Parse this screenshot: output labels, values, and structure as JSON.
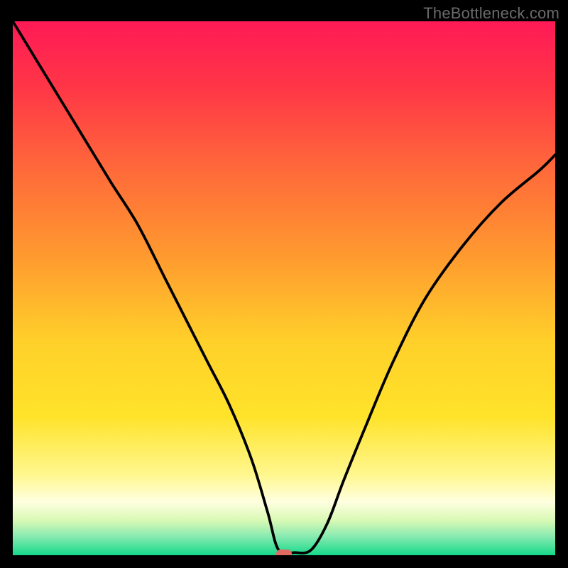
{
  "watermark": "TheBottleneck.com",
  "chart_data": {
    "type": "line",
    "title": "",
    "xlabel": "",
    "ylabel": "",
    "xlim": [
      0,
      100
    ],
    "ylim": [
      0,
      100
    ],
    "grid": false,
    "legend": false,
    "gradient_stops": [
      {
        "t": 0.0,
        "color": "#ff1a56"
      },
      {
        "t": 0.12,
        "color": "#ff3547"
      },
      {
        "t": 0.28,
        "color": "#ff6a3a"
      },
      {
        "t": 0.44,
        "color": "#ff9a2f"
      },
      {
        "t": 0.6,
        "color": "#ffd02a"
      },
      {
        "t": 0.74,
        "color": "#ffe32a"
      },
      {
        "t": 0.85,
        "color": "#fff78f"
      },
      {
        "t": 0.9,
        "color": "#ffffe0"
      },
      {
        "t": 0.935,
        "color": "#d8f9b5"
      },
      {
        "t": 0.965,
        "color": "#87eab0"
      },
      {
        "t": 1.0,
        "color": "#15d98a"
      }
    ],
    "marker": {
      "x": 50,
      "y": 0,
      "color": "#e26a63"
    },
    "series": [
      {
        "name": "curve",
        "x": [
          0,
          6,
          12,
          18,
          23,
          28,
          32,
          36,
          40,
          44,
          47,
          49,
          52,
          55,
          58,
          61,
          65,
          70,
          76,
          83,
          90,
          97,
          100
        ],
        "y": [
          100,
          90,
          80,
          70,
          62,
          52,
          44,
          36,
          28,
          18,
          8,
          1,
          0.5,
          1,
          6,
          14,
          24,
          36,
          48,
          58,
          66,
          72,
          75
        ]
      }
    ]
  }
}
